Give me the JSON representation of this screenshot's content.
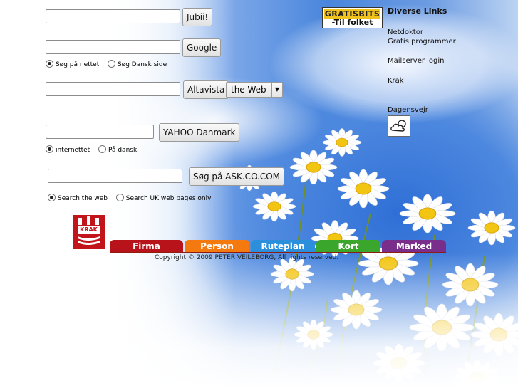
{
  "search": {
    "jubii": {
      "value": "",
      "button": "Jubii!"
    },
    "google": {
      "value": "",
      "button": "Google",
      "options": [
        "Søg på nettet",
        "Søg Dansk side"
      ],
      "selected_option": "Søg på nettet"
    },
    "altavista": {
      "value": "",
      "button": "Altavista",
      "scope_selected": "the Web"
    },
    "yahoo": {
      "value": "",
      "button": "YAHOO Danmark",
      "options": [
        "internettet",
        "På dansk"
      ],
      "selected_option": "internettet"
    },
    "ask": {
      "value": "",
      "button": "Søg på ASK.CO.COM",
      "options": [
        "Search the web",
        "Search UK web pages only"
      ],
      "selected_option": "Search the web"
    }
  },
  "logo": {
    "top": "GRATISBITS",
    "bottom": "-Til folket"
  },
  "links": {
    "title": "Diverse Links",
    "netdoktor": "Netdoktor",
    "gratis": "Gratis programmer",
    "mailserver": "Mailserver login",
    "krak": "Krak",
    "dagensvejr": "Dagensvejr"
  },
  "weather_icon": "cloud-sun-icon",
  "krak": {
    "logo_text": "KRAK",
    "tabs": [
      {
        "label": "Firma",
        "color": "#b8121a"
      },
      {
        "label": "Person",
        "color": "#f47a0f"
      },
      {
        "label": "Ruteplan",
        "color": "#2b8fdb"
      },
      {
        "label": "Kort",
        "color": "#3aa62c"
      },
      {
        "label": "Marked",
        "color": "#7a2e8c"
      }
    ]
  },
  "copyright": "Copyright © 2009 PETER VEILEBORG, All rights reserved."
}
